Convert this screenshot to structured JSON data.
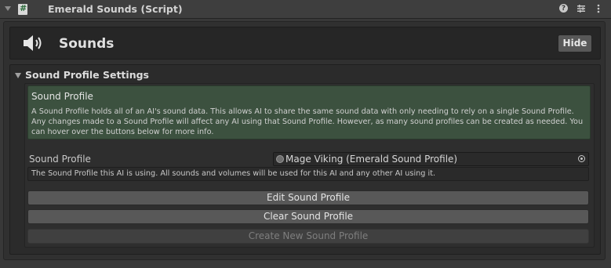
{
  "component": {
    "title": "Emerald Sounds (Script)",
    "icons": [
      "help-icon",
      "preset-icon",
      "menu-icon"
    ]
  },
  "header": {
    "title": "Sounds",
    "hide_label": "Hide",
    "icon": "speaker-icon"
  },
  "section": {
    "title": "Sound Profile Settings"
  },
  "info": {
    "heading": "Sound Profile",
    "body": "A Sound Profile holds all of an AI's sound data. This allows AI to share the same sound data with only needing to rely on a single Sound Profile. Any changes made to a Sound Profile will affect any AI using that Sound Profile. However, as many sound profiles can be created as needed. You can hover over the buttons below for more info."
  },
  "field": {
    "label": "Sound Profile",
    "value": "Mage Viking (Emerald Sound Profile)",
    "help": "The Sound Profile this AI is using. All sounds and volumes will be used for this AI and any other AI using it."
  },
  "buttons": {
    "edit": "Edit Sound Profile",
    "clear": "Clear Sound Profile",
    "create": "Create New Sound Profile"
  },
  "colors": {
    "info_background": "#3c513f",
    "panel_background": "#383838"
  }
}
